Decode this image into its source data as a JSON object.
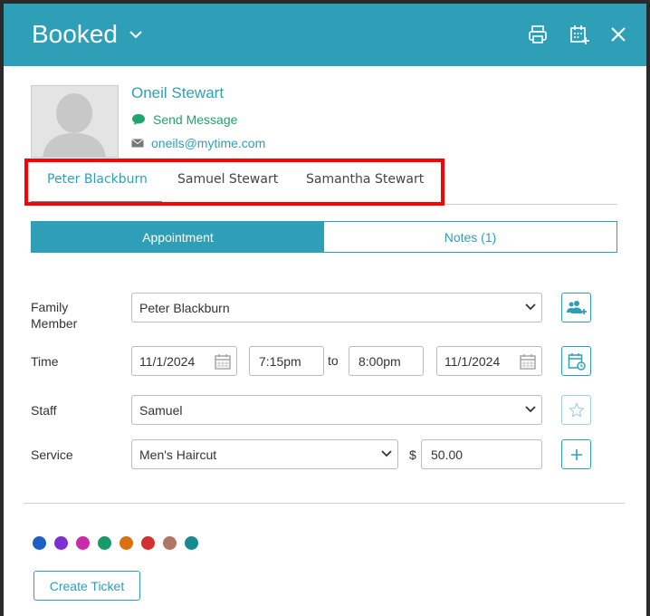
{
  "header": {
    "title": "Booked",
    "icons": [
      "chevron-down-icon",
      "print-icon",
      "calendar-add-icon",
      "close-icon"
    ],
    "bg_color": "#2f9fb8"
  },
  "client": {
    "name": "Oneil Stewart",
    "send_message": "Send Message",
    "email": "oneils@mytime.com"
  },
  "family_tabs": [
    "Peter Blackburn",
    "Samuel Stewart",
    "Samantha Stewart"
  ],
  "active_family_tab": "Peter Blackburn",
  "segments": {
    "appointment": "Appointment",
    "notes": "Notes (1)"
  },
  "form": {
    "family_member": {
      "label": "Family Member",
      "value": "Peter Blackburn"
    },
    "time": {
      "label": "Time",
      "start_date": "11/1/2024",
      "start_time": "7:15pm",
      "separator": "to",
      "end_time": "8:00pm",
      "end_date": "11/1/2024"
    },
    "staff": {
      "label": "Staff",
      "value": "Samuel"
    },
    "service": {
      "label": "Service",
      "value": "Men's Haircut",
      "currency": "$",
      "price": "50.00"
    }
  },
  "color_dots": [
    "#1f5fc4",
    "#7b2fd0",
    "#c92ca8",
    "#199a6a",
    "#d6720f",
    "#d33030",
    "#b07565",
    "#168a90"
  ],
  "actions": {
    "create_ticket": "Create Ticket"
  }
}
